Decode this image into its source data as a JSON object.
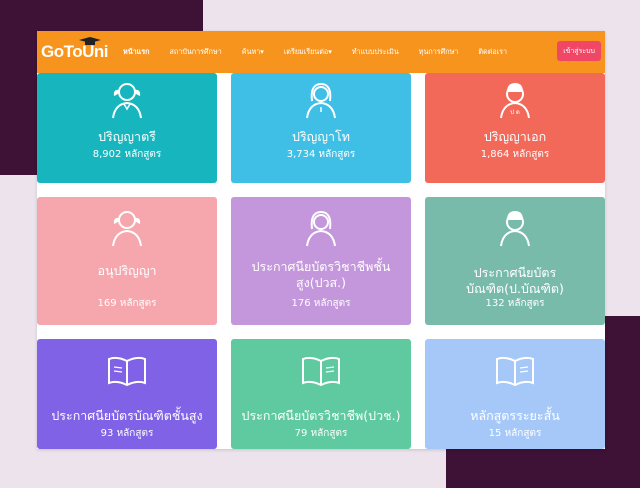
{
  "nav": {
    "logo_text": "GoToUni",
    "links": [
      "หน้าแรก",
      "สถาบันการศึกษา",
      "ค้นหา▾",
      "เตรียมเรียนต่อ▾",
      "ทำแบบประเมิน",
      "ทุนการศึกษา",
      "ติดต่อเรา"
    ],
    "login": "เข้าสู่ระบบ"
  },
  "cards": [
    {
      "title": "ปริญญาตรี",
      "count": "8,902 หลักสูตร",
      "color": "#17b6bf",
      "icon": "female-graduate-icon"
    },
    {
      "title": "ปริญญาโท",
      "count": "3,734 หลักสูตร",
      "color": "#3fbfe5",
      "icon": "female-graduate-icon"
    },
    {
      "title": "ปริญญาเอก",
      "count": "1,864 หลักสูตร",
      "color": "#f2695a",
      "icon": "male-graduate-icon"
    },
    {
      "title": "อนุปริญญา",
      "count": "169 หลักสูตร",
      "color": "#f6a6ad",
      "icon": "female-graduate-icon"
    },
    {
      "title": "ประกาศนียบัตรวิชาชีพชั้นสูง(ปวส.)",
      "count": "176 หลักสูตร",
      "color": "#c497dc",
      "icon": "female-graduate-icon"
    },
    {
      "title": "ประกาศนียบัตรบัณฑิต(ป.บัณฑิต)",
      "count": "132 หลักสูตร",
      "color": "#79bbab",
      "icon": "male-graduate-icon"
    },
    {
      "title": "ประกาศนียบัตรบัณฑิตชั้นสูง",
      "count": "93 หลักสูตร",
      "color": "#7f62e6",
      "icon": "open-book-icon"
    },
    {
      "title": "ประกาศนียบัตรวิชาชีพ(ปวช.)",
      "count": "79 หลักสูตร",
      "color": "#5fc9a0",
      "icon": "open-book-icon"
    },
    {
      "title": "หลักสูตรระยะสั้น",
      "count": "15 หลักสูตร",
      "color": "#a5c8f9",
      "icon": "open-book-icon"
    }
  ]
}
